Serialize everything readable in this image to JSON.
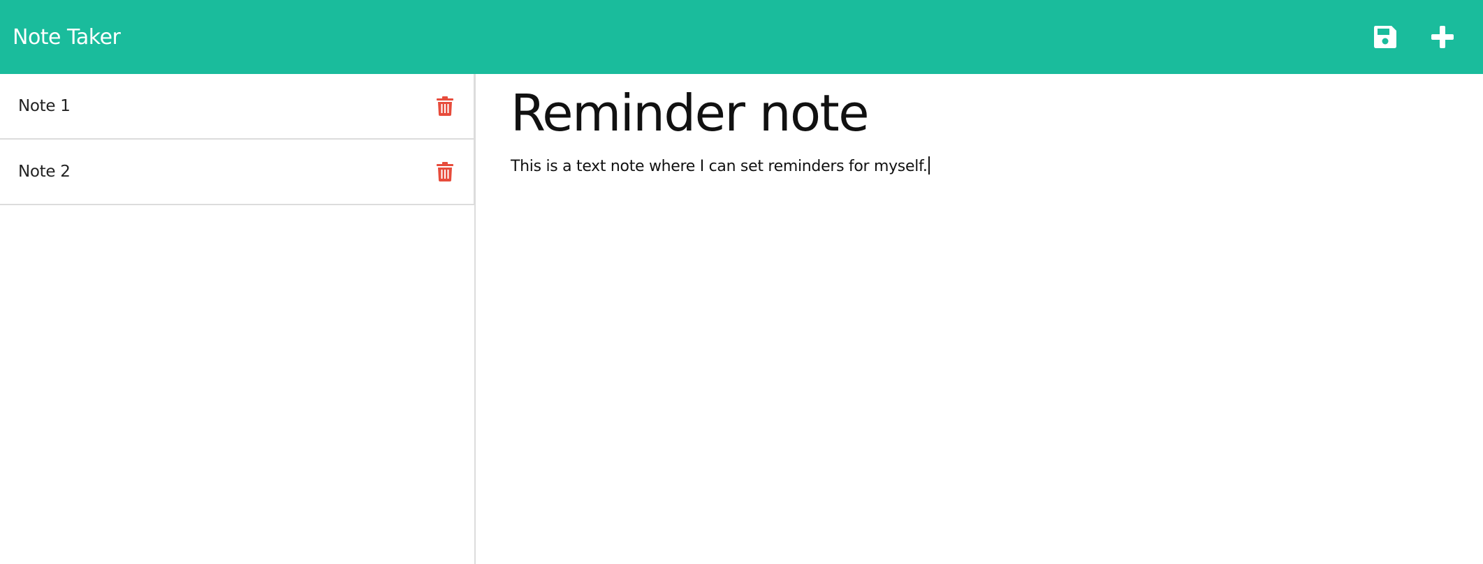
{
  "navbar": {
    "brand": "Note Taker",
    "save_icon": "floppy-disk-icon",
    "new_icon": "plus-icon",
    "background_color": "#1abc9c"
  },
  "sidebar": {
    "notes": [
      {
        "title": "Note 1",
        "delete_icon": "trash-icon"
      },
      {
        "title": "Note 2",
        "delete_icon": "trash-icon"
      }
    ],
    "delete_color": "#e74c3c"
  },
  "editor": {
    "title": "Reminder note",
    "text": "This is a text note where I can set reminders for myself."
  }
}
